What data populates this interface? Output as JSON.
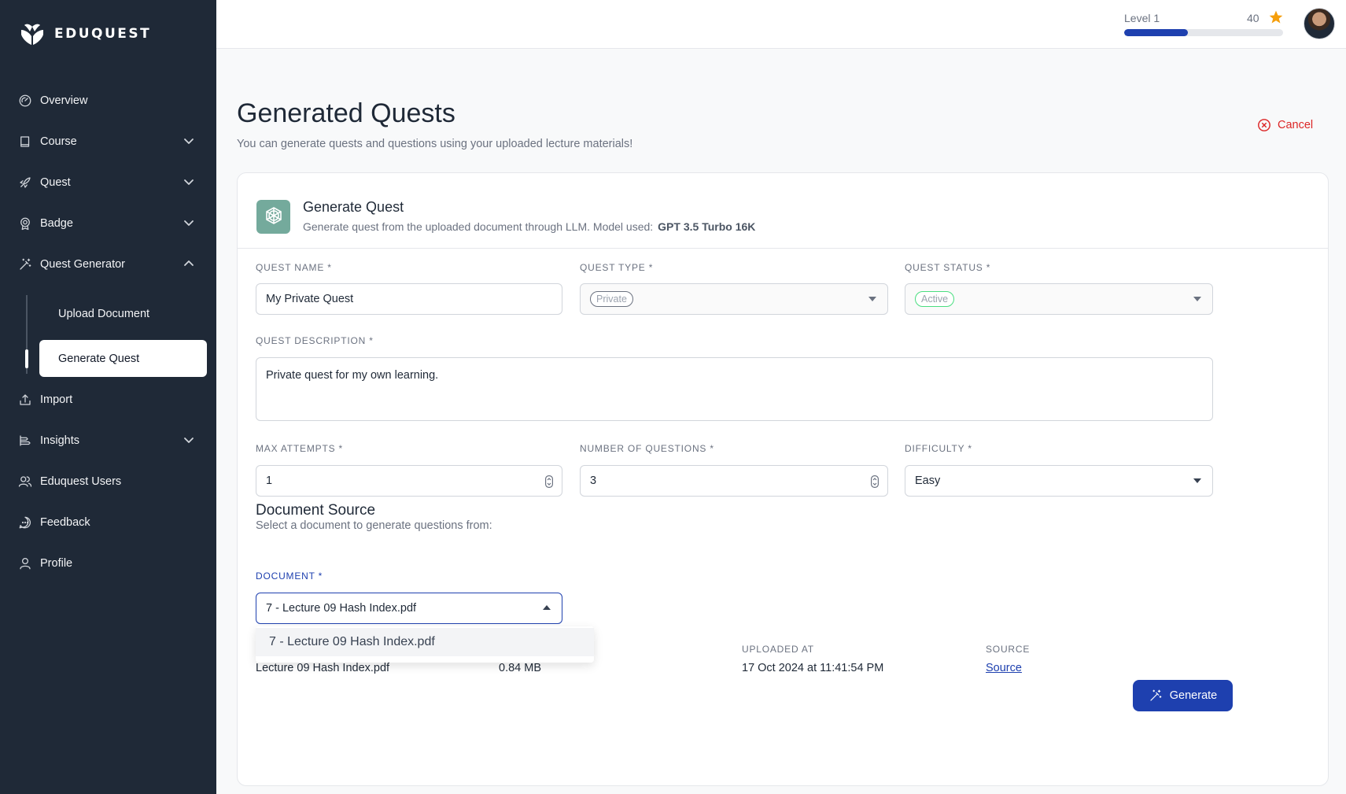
{
  "app": {
    "name": "EDUQUEST"
  },
  "sidebar": {
    "items": [
      {
        "label": "Overview",
        "icon": "gauge-icon"
      },
      {
        "label": "Course",
        "icon": "book-icon"
      },
      {
        "label": "Quest",
        "icon": "rocket-icon"
      },
      {
        "label": "Badge",
        "icon": "badge-icon"
      },
      {
        "label": "Quest Generator",
        "icon": "magic-wand-icon"
      },
      {
        "label": "Import",
        "icon": "upload-icon"
      },
      {
        "label": "Insights",
        "icon": "insights-icon"
      },
      {
        "label": "Eduquest Users",
        "icon": "users-icon"
      },
      {
        "label": "Feedback",
        "icon": "chat-icon"
      },
      {
        "label": "Profile",
        "icon": "user-icon"
      }
    ],
    "subitems": [
      {
        "label": "Upload Document"
      },
      {
        "label": "Generate Quest"
      }
    ],
    "active_subitem": "Generate Quest"
  },
  "topbar": {
    "level_label": "Level 1",
    "xp": "40",
    "progress": 0.4,
    "accent_color": "#1e40af",
    "star_color": "#f59e0b"
  },
  "main": {
    "title": "Generated Quests",
    "subtitle": "You can generate quests and questions using your uploaded lecture materials!",
    "cancel_label": "Cancel"
  },
  "card": {
    "title": "Generate Quest",
    "subtitle": "Generate quest from the uploaded document through LLM. Model used:",
    "model": "GPT 3.5 Turbo 16K"
  },
  "form": {
    "quest_name": {
      "label": "QUEST NAME *",
      "value": "My Private Quest"
    },
    "quest_type": {
      "label": "QUEST TYPE *",
      "value": "Private"
    },
    "quest_status": {
      "label": "QUEST STATUS *",
      "value": "Active"
    },
    "quest_description": {
      "label": "QUEST DESCRIPTION *",
      "value": "Private quest for my own learning."
    },
    "max_attempts": {
      "label": "MAX ATTEMPTS *",
      "value": "1"
    },
    "number_of_questions": {
      "label": "NUMBER OF QUESTIONS *",
      "value": "3"
    },
    "difficulty": {
      "label": "DIFFICULTY *",
      "value": "Easy"
    }
  },
  "document_source": {
    "title": "Document Source",
    "subtitle": "Select a document to generate questions from:",
    "document_label": "DOCUMENT *",
    "selected": "7 - Lecture 09 Hash Index.pdf",
    "options": [
      "7 - Lecture 09 Hash Index.pdf"
    ],
    "table": {
      "headers": {
        "uploaded_at": "UPLOADED AT",
        "source": "SOURCE"
      },
      "row": {
        "name": "Lecture 09 Hash Index.pdf",
        "size": "0.84 MB",
        "uploaded_at": "17 Oct 2024 at 11:41:54 PM",
        "source": "Source"
      }
    }
  },
  "generate_label": "Generate"
}
